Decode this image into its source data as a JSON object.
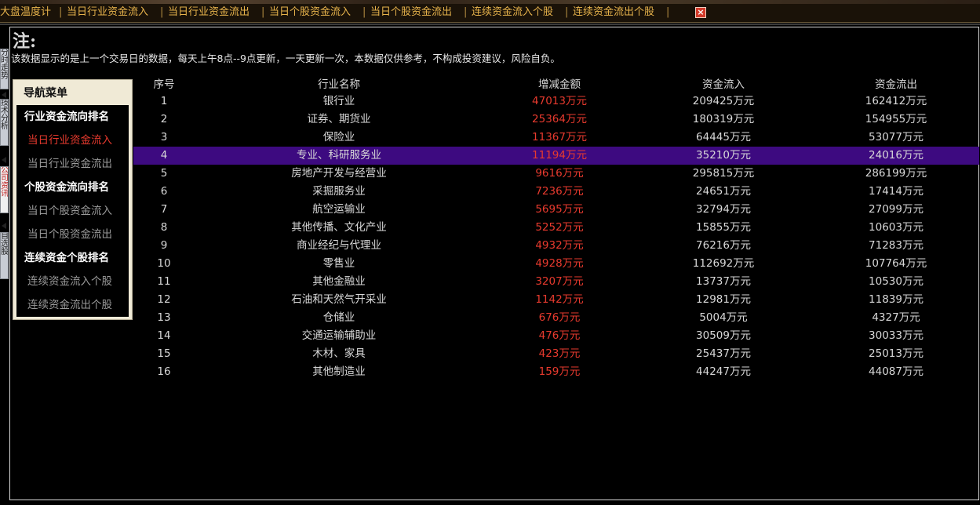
{
  "toolbar": {
    "links": [
      "大盘温度计",
      "当日行业资金流入",
      "当日行业资金流出",
      "当日个股资金流入",
      "当日个股资金流出",
      "连续资金流入个股",
      "连续资金流出个股"
    ],
    "close_symbol": "×"
  },
  "side_tabs": [
    "分时走势",
    "技术分析",
    "公司资讯",
    "自选股"
  ],
  "note": {
    "title": "注:",
    "text": "该数据显示的是上一个交易日的数据，每天上午8点--9点更新，一天更新一次，本数据仅供参考，不构成投资建议，风险自负。"
  },
  "nav": {
    "title": "导航菜单",
    "items": [
      {
        "label": "行业资金流向排名",
        "kind": "category"
      },
      {
        "label": "当日行业资金流入",
        "kind": "link",
        "active": true
      },
      {
        "label": "当日行业资金流出",
        "kind": "link"
      },
      {
        "label": "个股资金流向排名",
        "kind": "category"
      },
      {
        "label": "当日个股资金流入",
        "kind": "link"
      },
      {
        "label": "当日个股资金流出",
        "kind": "link"
      },
      {
        "label": "连续资金个股排名",
        "kind": "category"
      },
      {
        "label": "连续资金流入个股",
        "kind": "link"
      },
      {
        "label": "连续资金流出个股",
        "kind": "link"
      }
    ]
  },
  "table": {
    "headers": [
      "序号",
      "行业名称",
      "增减金额",
      "资金流入",
      "资金流出"
    ],
    "selected_index": 3,
    "rows": [
      [
        "1",
        "银行业",
        "47013万元",
        "209425万元",
        "162412万元"
      ],
      [
        "2",
        "证券、期货业",
        "25364万元",
        "180319万元",
        "154955万元"
      ],
      [
        "3",
        "保险业",
        "11367万元",
        "64445万元",
        "53077万元"
      ],
      [
        "4",
        "专业、科研服务业",
        "11194万元",
        "35210万元",
        "24016万元"
      ],
      [
        "5",
        "房地产开发与经营业",
        "9616万元",
        "295815万元",
        "286199万元"
      ],
      [
        "6",
        "采掘服务业",
        "7236万元",
        "24651万元",
        "17414万元"
      ],
      [
        "7",
        "航空运输业",
        "5695万元",
        "32794万元",
        "27099万元"
      ],
      [
        "8",
        "其他传播、文化产业",
        "5252万元",
        "15855万元",
        "10603万元"
      ],
      [
        "9",
        "商业经纪与代理业",
        "4932万元",
        "76216万元",
        "71283万元"
      ],
      [
        "10",
        "零售业",
        "4928万元",
        "112692万元",
        "107764万元"
      ],
      [
        "11",
        "其他金融业",
        "3207万元",
        "13737万元",
        "10530万元"
      ],
      [
        "12",
        "石油和天然气开采业",
        "1142万元",
        "12981万元",
        "11839万元"
      ],
      [
        "13",
        "仓储业",
        "676万元",
        "5004万元",
        "4327万元"
      ],
      [
        "14",
        "交通运输辅助业",
        "476万元",
        "30509万元",
        "30033万元"
      ],
      [
        "15",
        "木材、家具",
        "423万元",
        "25437万元",
        "25013万元"
      ],
      [
        "16",
        "其他制造业",
        "159万元",
        "44247万元",
        "44087万元"
      ]
    ]
  }
}
